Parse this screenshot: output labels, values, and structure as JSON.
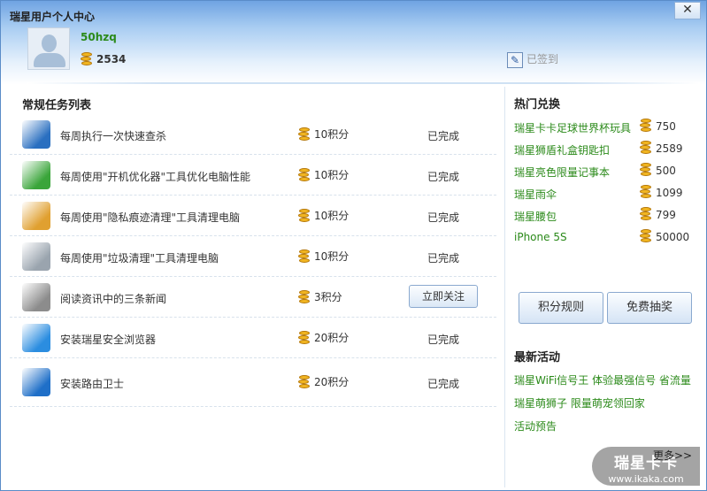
{
  "window": {
    "title": "瑞星用户个人中心",
    "close": "✕"
  },
  "user": {
    "name": "50hzq",
    "points": "2534",
    "signed": "已签到"
  },
  "tasks": {
    "title": "常规任务列表",
    "items": [
      {
        "name": "每周执行一次快速查杀",
        "points": "10积分",
        "status": "已完成",
        "color": "#2a6fc0"
      },
      {
        "name": "每周使用\"开机优化器\"工具优化电脑性能",
        "points": "10积分",
        "status": "已完成",
        "color": "#3aa53a"
      },
      {
        "name": "每周使用\"隐私痕迹清理\"工具清理电脑",
        "points": "10积分",
        "status": "已完成",
        "color": "#e0a030"
      },
      {
        "name": "每周使用\"垃圾清理\"工具清理电脑",
        "points": "10积分",
        "status": "已完成",
        "color": "#9aa4ae"
      },
      {
        "name": "阅读资讯中的三条新闻",
        "points": "3积分",
        "action": "立即关注",
        "color": "#8c8c8c"
      },
      {
        "name": "安装瑞星安全浏览器",
        "points": "20积分",
        "status": "已完成",
        "color": "#2b8de0"
      },
      {
        "name": "安装路由卫士",
        "points": "20积分",
        "status": "已完成",
        "color": "#1f6fc8"
      }
    ]
  },
  "exchange": {
    "title": "热门兑换",
    "items": [
      {
        "name": "瑞星卡卡足球世界杯玩具",
        "points": "750"
      },
      {
        "name": "瑞星狮盾礼盒钥匙扣",
        "points": "2589"
      },
      {
        "name": "瑞星亮色限量记事本",
        "points": "500"
      },
      {
        "name": "瑞星雨伞",
        "points": "1099"
      },
      {
        "name": "瑞星腰包",
        "points": "799"
      },
      {
        "name": "iPhone 5S",
        "points": "50000"
      }
    ],
    "rules": "积分规则",
    "lottery": "免费抽奖"
  },
  "activities": {
    "title": "最新活动",
    "items": [
      "瑞星WiFi信号王 体验最强信号 省流量",
      "瑞星萌狮子 限量萌宠领回家",
      "活动预告"
    ],
    "more": "更多>>"
  },
  "watermark": {
    "brand": "瑞星卡卡",
    "url": "www.ikaka.com"
  }
}
